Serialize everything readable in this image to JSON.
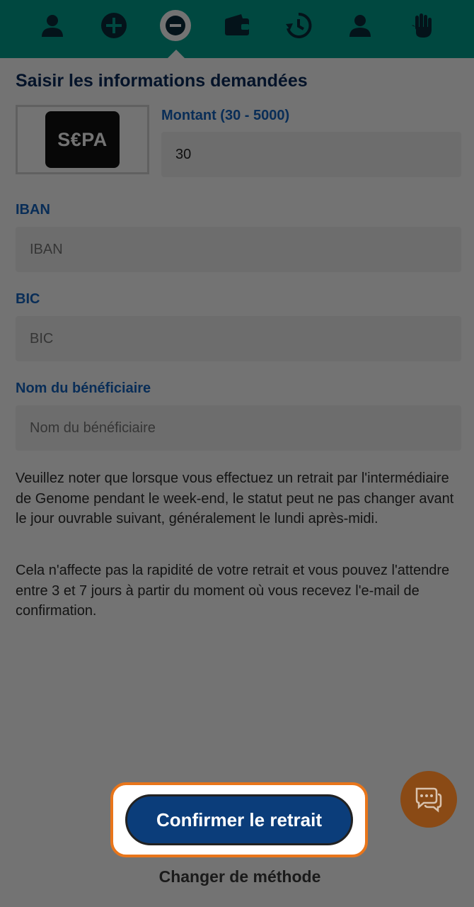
{
  "nav": {
    "items": [
      {
        "icon": "user-icon"
      },
      {
        "icon": "plus-circle-icon"
      },
      {
        "icon": "minus-circle-icon",
        "active": true
      },
      {
        "icon": "wallet-icon"
      },
      {
        "icon": "history-icon"
      },
      {
        "icon": "account-icon"
      },
      {
        "icon": "hand-icon"
      }
    ],
    "color": "#00a08f"
  },
  "page": {
    "title": "Saisir les informations demandées"
  },
  "method": {
    "logo_text": "S€PA"
  },
  "amount": {
    "label": "Montant (30 - 5000)",
    "value": "30"
  },
  "iban": {
    "label": "IBAN",
    "placeholder": "IBAN"
  },
  "bic": {
    "label": "BIC",
    "placeholder": "BIC"
  },
  "beneficiary": {
    "label": "Nom du bénéficiaire",
    "placeholder": "Nom du bénéficiaire"
  },
  "notes": {
    "p1": "Veuillez noter que lorsque vous effectuez un retrait par l'intermédiaire de Genome pendant le week-end, le statut peut ne pas changer avant le jour ouvrable suivant, généralement le lundi après-midi.",
    "p2": "Cela n'affecte pas la rapidité de votre retrait et vous pouvez l'attendre entre 3 et 7 jours à partir du moment où vous recevez l'e-mail de confirmation."
  },
  "actions": {
    "confirm_label": "Confirmer le retrait",
    "change_label": "Changer de méthode"
  },
  "chat": {
    "icon": "chat-icon",
    "color": "#e8751a"
  }
}
